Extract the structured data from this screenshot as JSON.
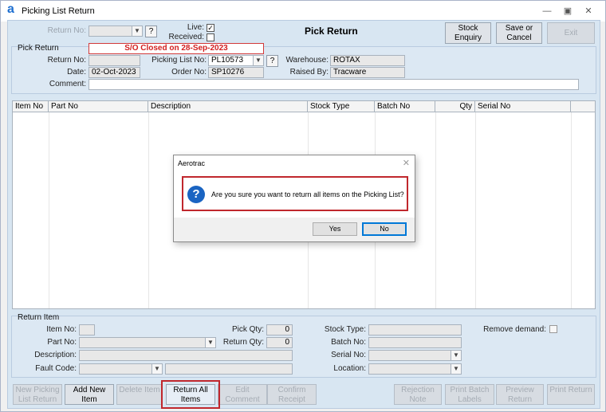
{
  "window": {
    "title": "Picking List Return",
    "logo": "a"
  },
  "header": {
    "return_no_label": "Return No:",
    "live_label": "Live:",
    "received_label": "Received:",
    "heading": "Pick Return",
    "stock_enquiry": "Stock Enquiry",
    "save_or_cancel": "Save or Cancel",
    "exit": "Exit"
  },
  "pick_return": {
    "section_title": "Pick Return",
    "status_banner": "S/O Closed on 28-Sep-2023",
    "return_no_label": "Return No:",
    "return_no_value": "",
    "picking_list_label": "Picking List No:",
    "picking_list_value": "PL10573",
    "warehouse_label": "Warehouse:",
    "warehouse_value": "ROTAX",
    "date_label": "Date:",
    "date_value": "02-Oct-2023",
    "order_no_label": "Order No:",
    "order_no_value": "SP10276",
    "raised_by_label": "Raised By:",
    "raised_by_value": "Tracware",
    "comment_label": "Comment:",
    "comment_value": ""
  },
  "grid": {
    "columns": [
      "Item No",
      "Part No",
      "Description",
      "Stock Type",
      "Batch No",
      "Qty",
      "Serial No"
    ]
  },
  "return_item": {
    "section_title": "Return Item",
    "item_no_label": "Item No:",
    "part_no_label": "Part No:",
    "description_label": "Description:",
    "fault_code_label": "Fault Code:",
    "pick_qty_label": "Pick Qty:",
    "pick_qty_value": "0",
    "return_qty_label": "Return Qty:",
    "return_qty_value": "0",
    "stock_type_label": "Stock Type:",
    "batch_no_label": "Batch No:",
    "serial_no_label": "Serial No:",
    "location_label": "Location:",
    "remove_demand_label": "Remove demand:"
  },
  "bottom_buttons": {
    "new_picking": "New Picking List Return",
    "add_new_item": "Add New Item",
    "delete_item": "Delete Item",
    "return_all_items": "Return All Items",
    "edit_comment": "Edit Comment",
    "confirm_receipt": "Confirm Receipt",
    "rejection_note": "Rejection Note",
    "print_batch_labels": "Print Batch Labels",
    "preview_return": "Preview Return",
    "print_return": "Print Return"
  },
  "dialog": {
    "title": "Aerotrac",
    "message": "Are you sure you want to return all items on the Picking List?",
    "yes": "Yes",
    "no": "No"
  },
  "colors": {
    "accent": "#1a64c2",
    "highlight": "#c0272d",
    "panel": "#d8e6f2"
  },
  "icons": [
    "app-logo-icon",
    "minimize-icon",
    "maximize-icon",
    "close-icon",
    "question-icon",
    "checkbox-checked-icon",
    "dropdown-arrow-icon"
  ]
}
